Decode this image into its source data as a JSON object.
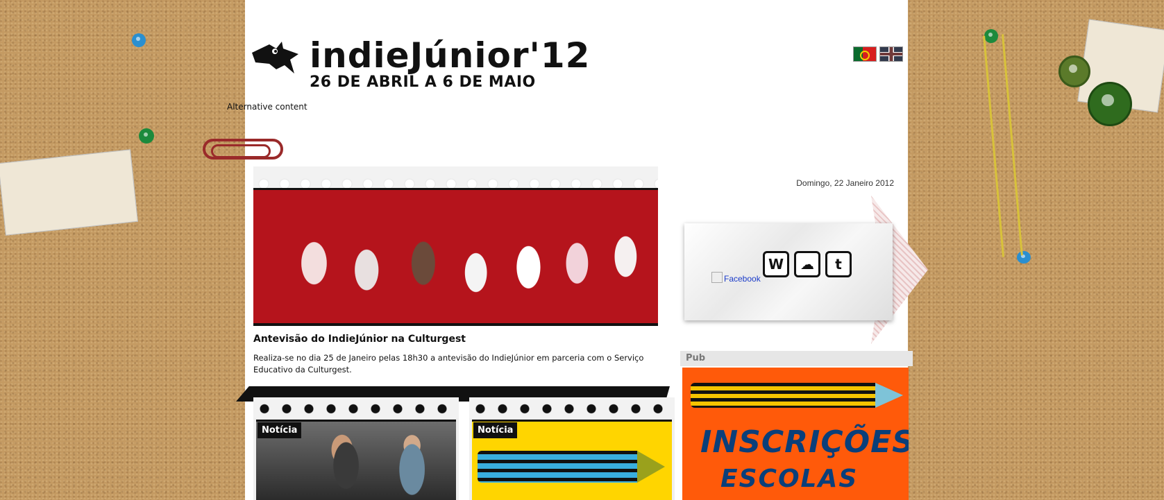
{
  "brand": {
    "name": "indieJúnior'12",
    "dates": "26 DE ABRIL A 6 DE MAIO"
  },
  "languages": [
    {
      "icon": "portugal-flag-icon",
      "label": "PT"
    },
    {
      "icon": "uk-flag-icon",
      "label": "EN"
    }
  ],
  "alt_content": "Alternative content",
  "date": "Domingo, 22 Janeiro 2012",
  "featured": {
    "title": "Antevisão do IndieJúnior na Culturgest",
    "text": "Realiza-se no dia 25 de Janeiro pelas 18h30 a antevisão do IndieJúnior em parceria com o Serviço Educativo da Culturgest."
  },
  "social": {
    "facebook_alt": "Facebook",
    "icons": [
      {
        "name": "wordpress-icon",
        "glyph": "W"
      },
      {
        "name": "cloud-icon",
        "glyph": "☁"
      },
      {
        "name": "twitter-icon",
        "glyph": "t"
      }
    ]
  },
  "pub": {
    "label": "Pub",
    "line1": "INSCRIÇÕES",
    "line2": "ESCOLAS"
  },
  "news": [
    {
      "tag": "Notícia"
    },
    {
      "tag": "Notícia"
    }
  ],
  "colors": {
    "cork": "#c49a62",
    "pub_orange": "#ff5a0a",
    "link_blue": "#1a3bc9"
  }
}
